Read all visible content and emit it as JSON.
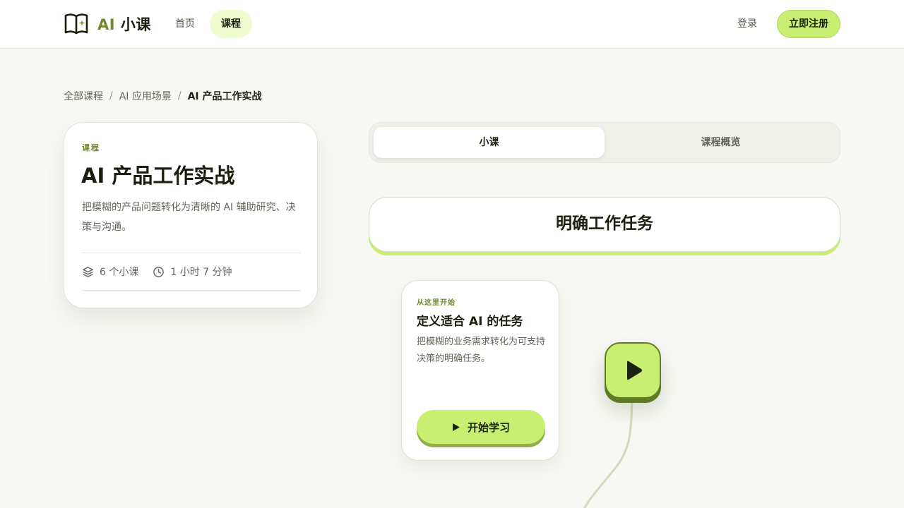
{
  "header": {
    "logo_prefix": "AI",
    "logo_suffix": "小课",
    "nav": {
      "home": "首页",
      "course": "课程"
    },
    "login": "登录",
    "signup": "立即注册"
  },
  "breadcrumb": {
    "items": [
      "全部课程",
      "AI 应用场景",
      "AI 产品工作实战"
    ],
    "separator": "/"
  },
  "course": {
    "kicker": "课程",
    "title": "AI 产品工作实战",
    "description": "把模糊的产品问题转化为清晰的 AI 辅助研究、决策与沟通。",
    "lessons_count": "6 个小课",
    "duration": "1 小时 7 分钟"
  },
  "tabs": {
    "lessons": "小课",
    "overview": "课程概览",
    "active": "小课"
  },
  "unit": {
    "title": "明确工作任务"
  },
  "lesson": {
    "kicker": "从这里开始",
    "title": "定义适合 AI 的任务",
    "description": "把模糊的业务需求转化为可支持决策的明确任务。",
    "start_label": "开始学习"
  },
  "colors": {
    "accent": "#c9ef72",
    "accent_dark": "#5f7a26",
    "brand_green": "#6f8a2c",
    "background": "#f7f8f3"
  },
  "icons": {
    "logo": "open-book-sparkle-icon",
    "lessons": "layers-icon",
    "duration": "clock-icon",
    "play": "play-icon"
  }
}
